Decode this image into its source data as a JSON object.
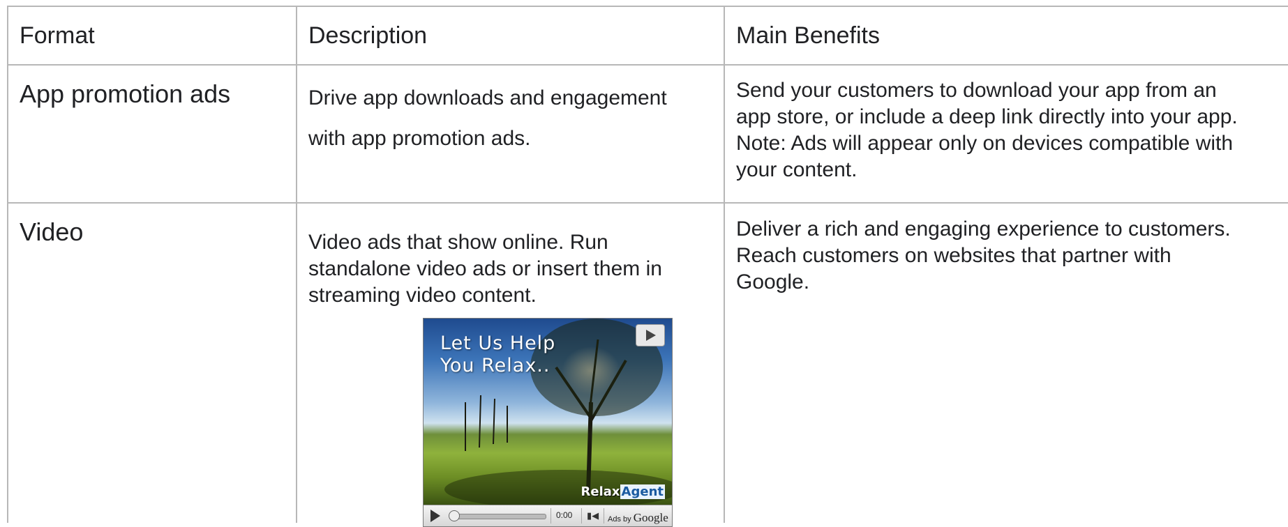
{
  "table": {
    "headers": [
      "Format",
      "Description",
      "Main Benefits"
    ],
    "rows": [
      {
        "format": "App promotion ads",
        "description": [
          "Drive app downloads and engagement",
          "with app promotion ads."
        ],
        "benefits": [
          "Send your customers to download your app from an",
          "app store, or include a deep link directly into your app.",
          "Note: Ads will appear only on devices compatible with",
          "your content."
        ]
      },
      {
        "format": "Video",
        "description": [
          "Video ads that show online. Run",
          "standalone video ads or insert them in",
          "streaming video content."
        ],
        "benefits": [
          "Deliver a rich and engaging experience to customers.",
          "Reach customers on websites that partner with",
          "Google."
        ]
      }
    ]
  },
  "video_ad": {
    "overlay_line1": "Let Us Help",
    "overlay_line2": "You Relax..",
    "brand_part1": "Relax",
    "brand_part2": "Agent",
    "time": "0:00",
    "ads_by_prefix": "Ads by",
    "ads_by_brand": "Google"
  }
}
